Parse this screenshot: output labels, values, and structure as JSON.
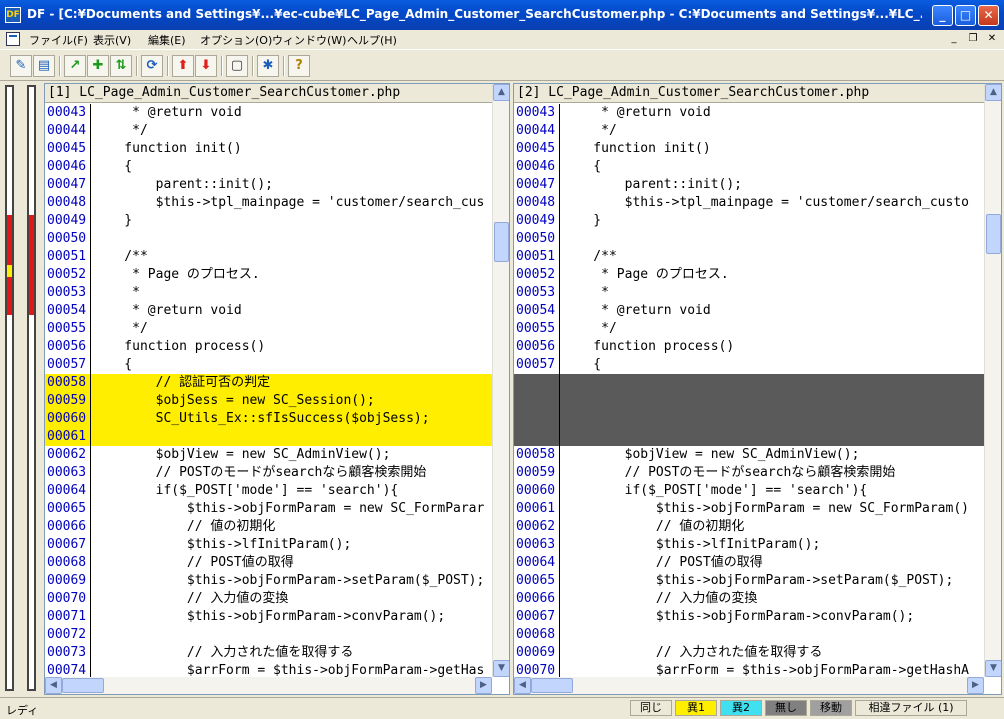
{
  "window": {
    "title": "DF - [C:¥Documents and Settings¥...¥ec-cube¥LC_Page_Admin_Customer_SearchCustomer.php  -  C:¥Documents and Settings¥...¥LC_...",
    "icon_text": "DF"
  },
  "menu": {
    "items": [
      "ファイル(F)",
      "表示(V)",
      "編集(E)",
      "オプション(O)",
      "ウィンドウ(W)",
      "ヘルプ(H)"
    ]
  },
  "toolbar": {
    "buttons": [
      "compare-icon",
      "open-icon",
      "prev-diff-icon",
      "next-diff-icon",
      "first-diff-icon",
      "refresh-icon",
      "copy-to-right-icon",
      "copy-to-left-icon",
      "window-icon",
      "merge-icon",
      "help-icon"
    ]
  },
  "left": {
    "title": "[1] LC_Page_Admin_Customer_SearchCustomer.php",
    "rows": [
      {
        "n": "00043",
        "t": "     * @return void",
        "k": ""
      },
      {
        "n": "00044",
        "t": "     */",
        "k": ""
      },
      {
        "n": "00045",
        "t": "    function init()",
        "k": ""
      },
      {
        "n": "00046",
        "t": "    {",
        "k": ""
      },
      {
        "n": "00047",
        "t": "        parent::init();",
        "k": ""
      },
      {
        "n": "00048",
        "t": "        $this->tpl_mainpage = 'customer/search_cus",
        "k": ""
      },
      {
        "n": "00049",
        "t": "    }",
        "k": ""
      },
      {
        "n": "00050",
        "t": "",
        "k": ""
      },
      {
        "n": "00051",
        "t": "    /**",
        "k": ""
      },
      {
        "n": "00052",
        "t": "     * Page のプロセス.",
        "k": ""
      },
      {
        "n": "00053",
        "t": "     *",
        "k": ""
      },
      {
        "n": "00054",
        "t": "     * @return void",
        "k": ""
      },
      {
        "n": "00055",
        "t": "     */",
        "k": ""
      },
      {
        "n": "00056",
        "t": "    function process()",
        "k": ""
      },
      {
        "n": "00057",
        "t": "    {",
        "k": ""
      },
      {
        "n": "00058",
        "t": "        // 認証可否の判定",
        "k": "hl"
      },
      {
        "n": "00059",
        "t": "        $objSess = new SC_Session();",
        "k": "hl"
      },
      {
        "n": "00060",
        "t": "        SC_Utils_Ex::sfIsSuccess($objSess);",
        "k": "hl"
      },
      {
        "n": "00061",
        "t": "",
        "k": "hl"
      },
      {
        "n": "00062",
        "t": "        $objView = new SC_AdminView();",
        "k": ""
      },
      {
        "n": "00063",
        "t": "        // POSTのモードがsearchなら顧客検索開始",
        "k": ""
      },
      {
        "n": "00064",
        "t": "        if($_POST['mode'] == 'search'){",
        "k": ""
      },
      {
        "n": "00065",
        "t": "            $this->objFormParam = new SC_FormParar",
        "k": ""
      },
      {
        "n": "00066",
        "t": "            // 値の初期化",
        "k": ""
      },
      {
        "n": "00067",
        "t": "            $this->lfInitParam();",
        "k": ""
      },
      {
        "n": "00068",
        "t": "            // POST値の取得",
        "k": ""
      },
      {
        "n": "00069",
        "t": "            $this->objFormParam->setParam($_POST);",
        "k": ""
      },
      {
        "n": "00070",
        "t": "            // 入力値の変換",
        "k": ""
      },
      {
        "n": "00071",
        "t": "            $this->objFormParam->convParam();",
        "k": ""
      },
      {
        "n": "00072",
        "t": "",
        "k": ""
      },
      {
        "n": "00073",
        "t": "            // 入力された値を取得する",
        "k": ""
      },
      {
        "n": "00074",
        "t": "            $arrForm = $this->objFormParam->getHas",
        "k": ""
      }
    ]
  },
  "right": {
    "title": "[2] LC_Page_Admin_Customer_SearchCustomer.php",
    "rows": [
      {
        "n": "00043",
        "t": "     * @return void",
        "k": ""
      },
      {
        "n": "00044",
        "t": "     */",
        "k": ""
      },
      {
        "n": "00045",
        "t": "    function init()",
        "k": ""
      },
      {
        "n": "00046",
        "t": "    {",
        "k": ""
      },
      {
        "n": "00047",
        "t": "        parent::init();",
        "k": ""
      },
      {
        "n": "00048",
        "t": "        $this->tpl_mainpage = 'customer/search_custo",
        "k": ""
      },
      {
        "n": "00049",
        "t": "    }",
        "k": ""
      },
      {
        "n": "00050",
        "t": "",
        "k": ""
      },
      {
        "n": "00051",
        "t": "    /**",
        "k": ""
      },
      {
        "n": "00052",
        "t": "     * Page のプロセス.",
        "k": ""
      },
      {
        "n": "00053",
        "t": "     *",
        "k": ""
      },
      {
        "n": "00054",
        "t": "     * @return void",
        "k": ""
      },
      {
        "n": "00055",
        "t": "     */",
        "k": ""
      },
      {
        "n": "00056",
        "t": "    function process()",
        "k": ""
      },
      {
        "n": "00057",
        "t": "    {",
        "k": ""
      },
      {
        "n": "",
        "t": "",
        "k": "gap"
      },
      {
        "n": "",
        "t": "",
        "k": "gap"
      },
      {
        "n": "",
        "t": "",
        "k": "gap"
      },
      {
        "n": "",
        "t": "",
        "k": "gap"
      },
      {
        "n": "00058",
        "t": "        $objView = new SC_AdminView();",
        "k": ""
      },
      {
        "n": "00059",
        "t": "        // POSTのモードがsearchなら顧客検索開始",
        "k": ""
      },
      {
        "n": "00060",
        "t": "        if($_POST['mode'] == 'search'){",
        "k": ""
      },
      {
        "n": "00061",
        "t": "            $this->objFormParam = new SC_FormParam()",
        "k": ""
      },
      {
        "n": "00062",
        "t": "            // 値の初期化",
        "k": ""
      },
      {
        "n": "00063",
        "t": "            $this->lfInitParam();",
        "k": ""
      },
      {
        "n": "00064",
        "t": "            // POST値の取得",
        "k": ""
      },
      {
        "n": "00065",
        "t": "            $this->objFormParam->setParam($_POST);",
        "k": ""
      },
      {
        "n": "00066",
        "t": "            // 入力値の変換",
        "k": ""
      },
      {
        "n": "00067",
        "t": "            $this->objFormParam->convParam();",
        "k": ""
      },
      {
        "n": "00068",
        "t": "",
        "k": ""
      },
      {
        "n": "00069",
        "t": "            // 入力された値を取得する",
        "k": ""
      },
      {
        "n": "00070",
        "t": "            $arrForm = $this->objFormParam->getHashA",
        "k": ""
      }
    ]
  },
  "status": {
    "text": "レディ",
    "legend": [
      {
        "label": "同じ",
        "color": "#ece9d8"
      },
      {
        "label": "異1",
        "color": "#ffee00"
      },
      {
        "label": "異2",
        "color": "#40e0f0"
      },
      {
        "label": "無し",
        "color": "#808080"
      },
      {
        "label": "移動",
        "color": "#a0a0a0"
      },
      {
        "label": "相違ファイル (1)",
        "color": "#ece9d8"
      }
    ]
  },
  "colors": {
    "diff1": "#ffee00",
    "missing": "#5a5a5a",
    "line_number": "#0000c0"
  }
}
